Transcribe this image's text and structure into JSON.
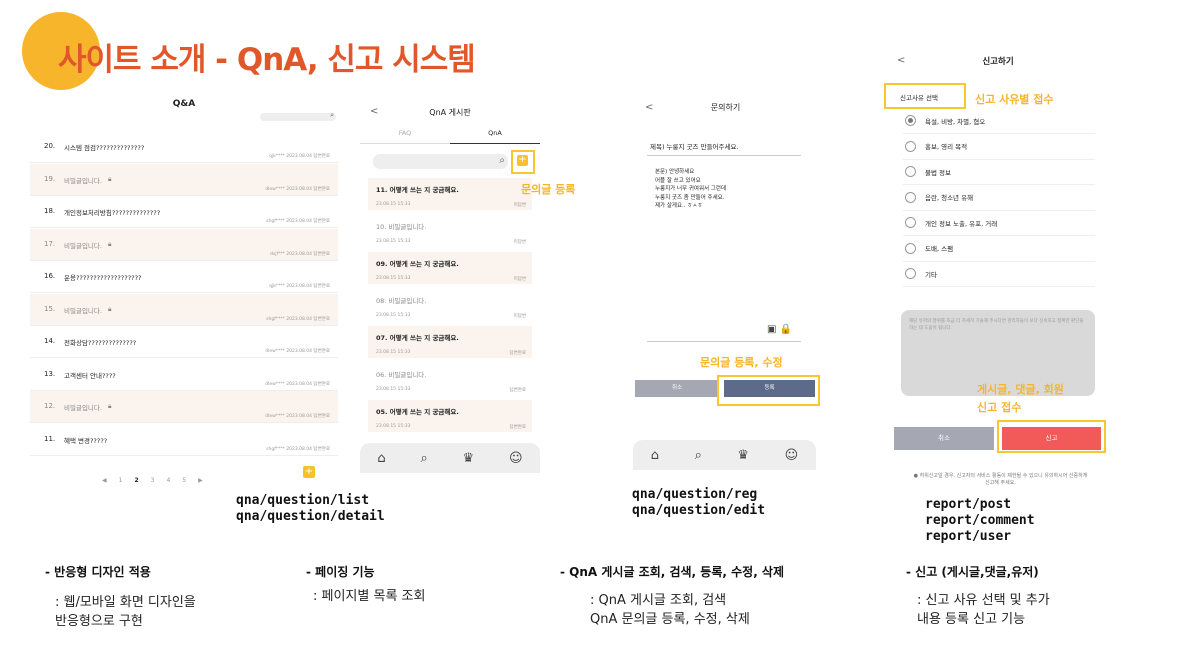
{
  "slide": {
    "title": "사이트 소개 - QnA, 신고 시스템",
    "accent_color": "#F7B52C",
    "title_color": "#E2572A"
  },
  "qna_list": {
    "title": "Q&A",
    "search_icon": "search-icon",
    "rows": [
      {
        "num": "20.",
        "text": "시스템 점검??????????????",
        "meta": "qjk****    2023.08.04    답변완료",
        "secret": false,
        "shade": false
      },
      {
        "num": "19.",
        "text": "비밀글입니다.",
        "meta": "dlew****    2023.08.04    답변완료",
        "secret": true,
        "shade": true
      },
      {
        "num": "18.",
        "text": "개인정보처리방침??????????????",
        "meta": "shgf****    2023.08.04    답변완료",
        "secret": false,
        "shade": false
      },
      {
        "num": "17.",
        "text": "비밀글입니다.",
        "meta": "dsjf***    2023.08.04    답변완료",
        "secret": true,
        "shade": true
      },
      {
        "num": "16.",
        "text": "운용???????????????????",
        "meta": "qjk****    2023.08.04    답변완료",
        "secret": false,
        "shade": false
      },
      {
        "num": "15.",
        "text": "비밀글입니다.",
        "meta": "shgf****    2023.08.04    답변완료",
        "secret": true,
        "shade": true
      },
      {
        "num": "14.",
        "text": "전화상담??????????????",
        "meta": "dlew****    2023.08.04    답변완료",
        "secret": false,
        "shade": false
      },
      {
        "num": "13.",
        "text": "고객센터 안내????",
        "meta": "dlew****    2023.08.04    답변완료",
        "secret": false,
        "shade": false
      },
      {
        "num": "12.",
        "text": "비밀글입니다.",
        "meta": "dlew****    2023.08.04    답변완료",
        "secret": true,
        "shade": true
      },
      {
        "num": "11.",
        "text": "혜택 변경?????",
        "meta": "shgf****    2023.08.04    답변완료",
        "secret": false,
        "shade": false
      }
    ],
    "pager": [
      "◀",
      "1",
      "2",
      "3",
      "4",
      "5",
      "▶"
    ],
    "write_button": "+"
  },
  "qna_board": {
    "back": "<",
    "title": "QnA 게시판",
    "tabs": [
      "FAQ",
      "QnA"
    ],
    "plus": "+",
    "rows": [
      {
        "title": "11.   어떻게 쓰는 지 궁금해요.",
        "date": "23.08.15 15:33",
        "status": "미답변",
        "secret": false,
        "shade": true
      },
      {
        "title": "10. 비밀글입니다.",
        "date": "23.08.15 15:33",
        "status": "미답변",
        "secret": true,
        "shade": false
      },
      {
        "title": "09.   어떻게 쓰는 지 궁금해요.",
        "date": "23.08.15 15:33",
        "status": "미답변",
        "secret": false,
        "shade": true
      },
      {
        "title": "08. 비밀글입니다.",
        "date": "23.08.15 15:33",
        "status": "미답변",
        "secret": true,
        "shade": false
      },
      {
        "title": "07.   어떻게 쓰는 지 궁금해요.",
        "date": "23.08.15 15:33",
        "status": "답변완료",
        "secret": false,
        "shade": true
      },
      {
        "title": "06. 비밀글입니다.",
        "date": "23.08.15 15:33",
        "status": "답변완료",
        "secret": true,
        "shade": false
      },
      {
        "title": "05.   어떻게 쓰는 지 궁금해요.",
        "date": "23.08.15 15:33",
        "status": "답변완료",
        "secret": false,
        "shade": true
      }
    ],
    "nav_icons": [
      "⌂",
      "⌕",
      "♛",
      "☺"
    ]
  },
  "inquiry": {
    "back": "<",
    "title": "문의하기",
    "subject": "제목) 누룽지 굿즈 만들어주세요.",
    "body": "본문) 안녕하세요\n어플 잘 쓰고 있어요\n누룽지가 너무 귀여워서 그런데\n누룽지 굿즈 좀 만들어 주세요.\n제가 살게요.. ㅎㅅㅎ",
    "attach_icons": "▣ 🔒",
    "cancel": "취소",
    "submit": "등록",
    "nav_icons": [
      "⌂",
      "⌕",
      "♛",
      "☺"
    ]
  },
  "report": {
    "back": "<",
    "title": "신고하기",
    "reason_label": "신고사유 선택",
    "options": [
      {
        "label": "욕설, 비방, 차별, 혐오",
        "checked": true
      },
      {
        "label": "홍보, 영리 목적",
        "checked": false
      },
      {
        "label": "불법 정보",
        "checked": false
      },
      {
        "label": "음란, 청소년 유해",
        "checked": false
      },
      {
        "label": "개인 정보 노출, 유포, 거래",
        "checked": false
      },
      {
        "label": "도배, 스팸",
        "checked": false
      },
      {
        "label": "기타",
        "checked": false
      }
    ],
    "textarea_placeholder": "해당 유저의 행위를 조금 더 자세히 기술해 주시다면 관리자들이 보다 신속하고 정확한 판단을 하는 데 도움이 됩니다.",
    "cancel": "취소",
    "submit": "신고",
    "notice": "● 허위신고일 경우, 신고자의 서비스 활동이 제한될 수 있으니 유의하시어 신중하게 신고해 주세요."
  },
  "annotations": {
    "register_post": "문의글 등록",
    "register_edit": "문의글 등록, 수정",
    "report_reason": "신고 사유별 접수",
    "report_targets_1": "게시글, 댓글, 회원",
    "report_targets_2": "신고 접수"
  },
  "routes": {
    "r1a": "qna/question/list",
    "r1b": "qna/question/detail",
    "r2a": "qna/question/reg",
    "r2b": "qna/question/edit",
    "r3a": "report/post",
    "r3b": "report/comment",
    "r3c": "report/user"
  },
  "features": [
    {
      "heading": "- 반응형 디자인 적용",
      "desc1": ": 웹/모바일 화면 디자인을",
      "desc2": "반응형으로 구현"
    },
    {
      "heading": "- 페이징 기능",
      "desc1": ": 페이지별 목록 조회",
      "desc2": ""
    },
    {
      "heading": "- QnA 게시글 조회, 검색, 등록, 수정, 삭제",
      "desc1": ": QnA 게시글 조회, 검색",
      "desc2": "QnA 문의글 등록, 수정, 삭제"
    },
    {
      "heading": "- 신고 (게시글,댓글,유저)",
      "desc1": ": 신고 사유 선택 및 추가",
      "desc2": "내용 등록 신고 기능"
    }
  ]
}
